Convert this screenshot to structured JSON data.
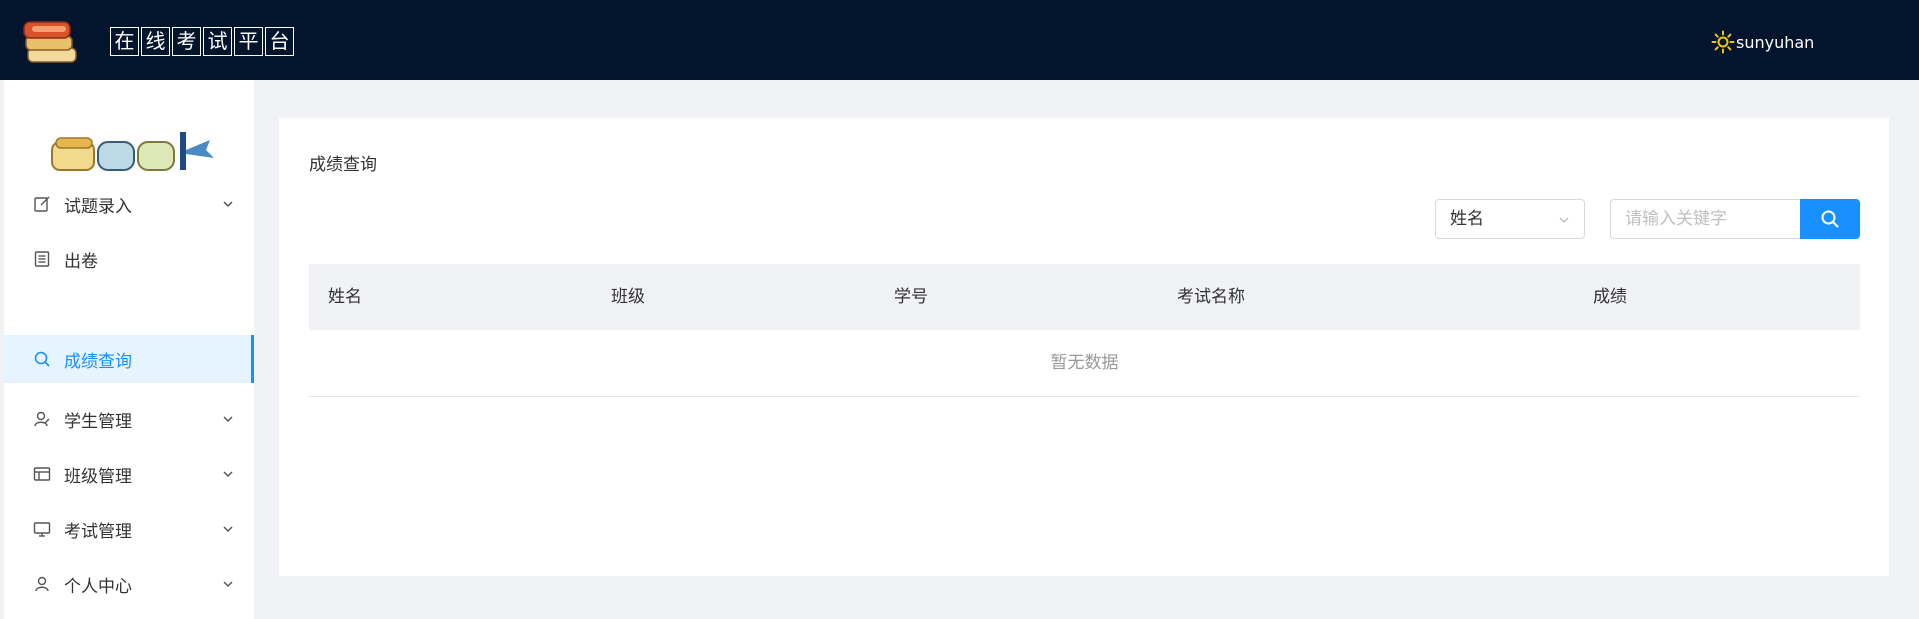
{
  "header": {
    "brand_chars": [
      "在",
      "线",
      "考",
      "试",
      "平",
      "台"
    ],
    "username": "sunyuhan"
  },
  "sidebar": {
    "items": [
      {
        "label": "试题录入",
        "icon": "edit-icon",
        "has_arrow": true
      },
      {
        "label": "出卷",
        "icon": "document-icon",
        "has_arrow": false
      },
      {
        "label": "成绩查询",
        "icon": "search-icon",
        "has_arrow": false,
        "active": true
      },
      {
        "label": "学生管理",
        "icon": "user-manage-icon",
        "has_arrow": true
      },
      {
        "label": "班级管理",
        "icon": "table-icon",
        "has_arrow": true
      },
      {
        "label": "考试管理",
        "icon": "monitor-icon",
        "has_arrow": true
      },
      {
        "label": "个人中心",
        "icon": "user-icon",
        "has_arrow": true
      }
    ]
  },
  "main": {
    "title": "成绩查询",
    "filter": {
      "selected": "姓名",
      "placeholder": "请输入关键字",
      "value": ""
    },
    "table": {
      "columns": [
        "姓名",
        "班级",
        "学号",
        "考试名称",
        "成绩"
      ],
      "empty_text": "暂无数据"
    }
  },
  "colors": {
    "header_bg": "#02152c",
    "accent": "#1890ff",
    "active_bg": "#e6f4ff",
    "page_bg": "#f0f2f5"
  }
}
